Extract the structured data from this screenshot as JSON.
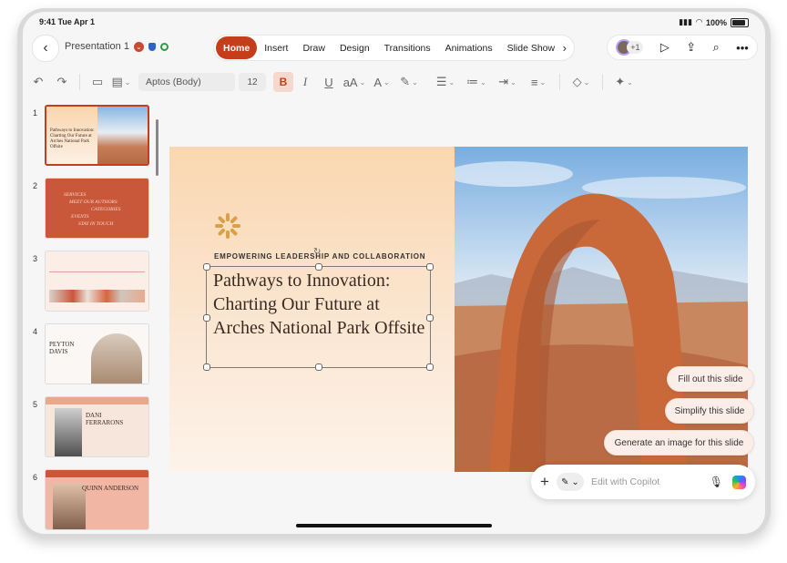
{
  "status_bar": {
    "time": "9:41",
    "date": "Tue Apr 1",
    "battery": "100%"
  },
  "top_bar": {
    "back_icon": "chevron-left-icon",
    "document_title": "Presentation 1"
  },
  "tabs": [
    {
      "label": "Home",
      "active": true
    },
    {
      "label": "Insert"
    },
    {
      "label": "Draw"
    },
    {
      "label": "Design"
    },
    {
      "label": "Transitions"
    },
    {
      "label": "Animations"
    },
    {
      "label": "Slide Show"
    }
  ],
  "collaborators": {
    "extra_count": "+1"
  },
  "ribbon": {
    "font_name": "Aptos (Body)",
    "font_size": "12",
    "bold_label": "B",
    "italic_label": "I",
    "underline_label": "U",
    "text_size_label": "aA"
  },
  "thumbnails": [
    {
      "number": "1",
      "title": "Pathways to Innovation: Charting Our Future at Arches National Park Offsite",
      "selected": true
    },
    {
      "number": "2",
      "lines": [
        "SERVICES",
        "MEET OUR AUTHORS",
        "CATEGORIES",
        "EVENTS",
        "STAY IN TOUCH"
      ]
    },
    {
      "number": "3"
    },
    {
      "number": "4",
      "name": "PEYTON DAVIS"
    },
    {
      "number": "5",
      "name": "DANI FERRARONS"
    },
    {
      "number": "6",
      "name": "QUINN ANDERSON"
    }
  ],
  "slide": {
    "kicker": "EMPOWERING LEADERSHIP AND COLLABORATION",
    "title": "Pathways to Innovation: Charting Our Future at Arches National Park Offsite"
  },
  "copilot": {
    "suggestions": [
      "Fill out this slide",
      "Simplify this slide",
      "Generate an image for this slide"
    ],
    "placeholder": "Edit with Copilot"
  },
  "colors": {
    "accent": "#c43e1c",
    "slide_bg": "#fad7b0"
  }
}
